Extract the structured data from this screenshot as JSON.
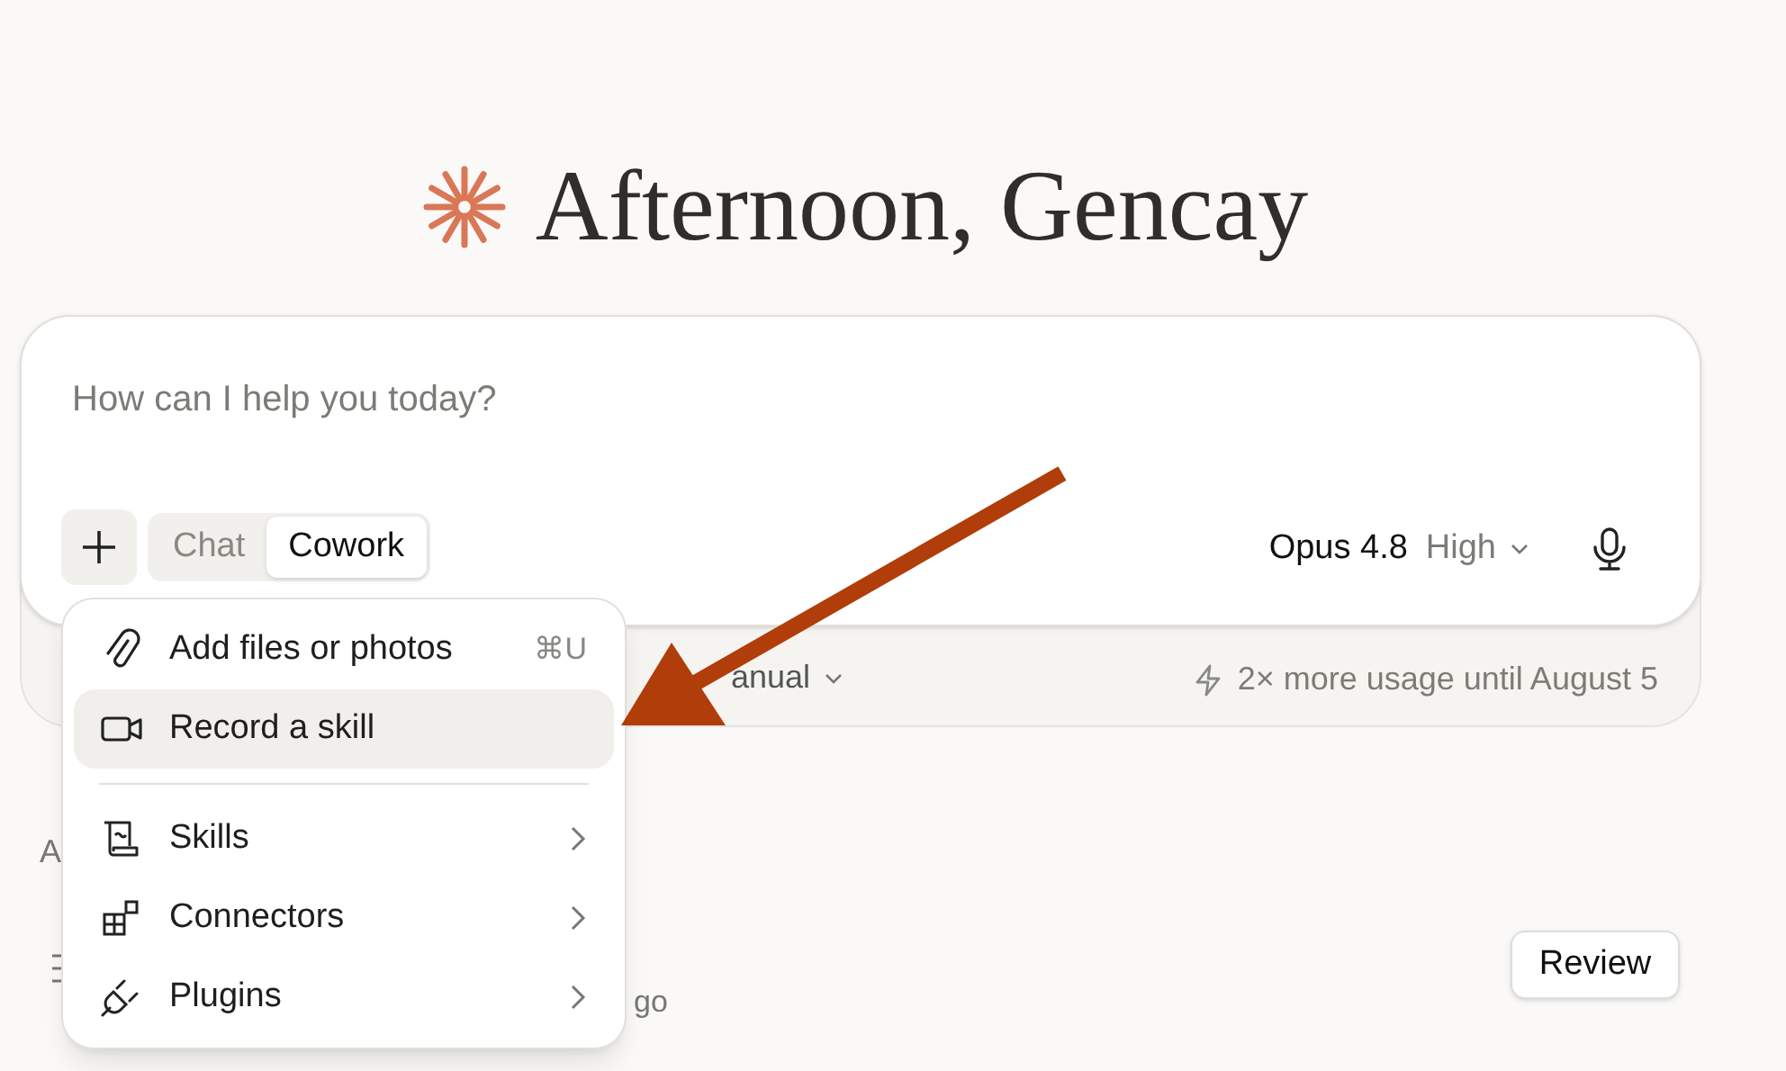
{
  "greeting": "Afternoon, Gencay",
  "composer": {
    "placeholder": "How can I help you today?",
    "modes": [
      {
        "label": "Chat",
        "selected": false
      },
      {
        "label": "Cowork",
        "selected": true
      }
    ],
    "model": "Opus 4.8",
    "effort": "High"
  },
  "footer": {
    "mode": "anual",
    "usage": "2× more usage until August 5"
  },
  "menu": {
    "groups": [
      [
        {
          "kind": "attach",
          "label": "Add files or photos",
          "shortcut": "⌘U",
          "selected": false,
          "submenu": false
        },
        {
          "kind": "record",
          "label": "Record a skill",
          "selected": true,
          "submenu": false
        }
      ],
      [
        {
          "kind": "skills",
          "label": "Skills",
          "selected": false,
          "submenu": true
        },
        {
          "kind": "connectors",
          "label": "Connectors",
          "selected": false,
          "submenu": true
        },
        {
          "kind": "plugins",
          "label": "Plugins",
          "selected": false,
          "submenu": true
        }
      ]
    ]
  },
  "section_label": "A",
  "task": {
    "time_fragment": "go",
    "action": "Review"
  }
}
